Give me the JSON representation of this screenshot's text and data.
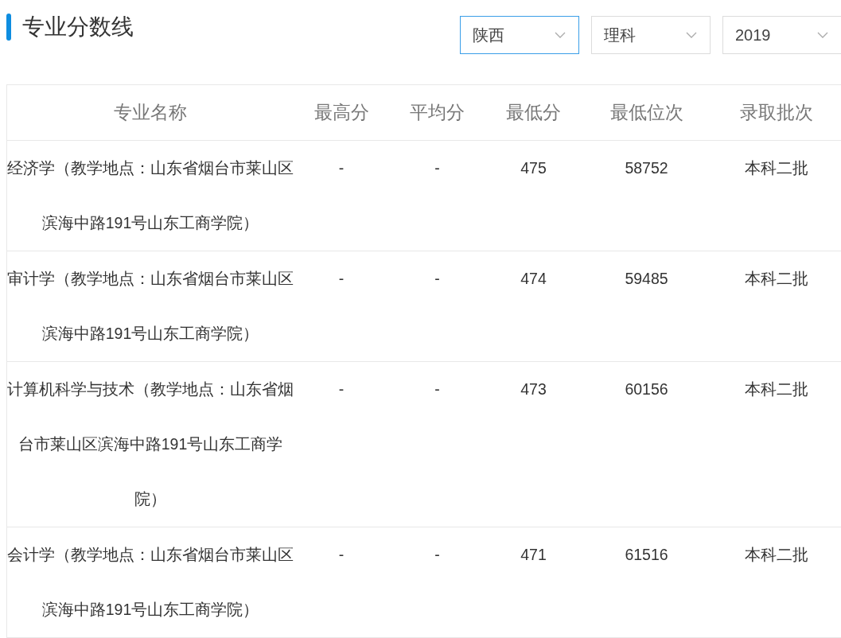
{
  "title": "专业分数线",
  "filters": [
    {
      "value": "陕西",
      "focused": true
    },
    {
      "value": "理科",
      "focused": false
    },
    {
      "value": "2019",
      "focused": false
    }
  ],
  "table": {
    "columns": [
      "专业名称",
      "最高分",
      "平均分",
      "最低分",
      "最低位次",
      "录取批次"
    ],
    "rows": [
      [
        "经济学（教学地点：山东省烟台市莱山区滨海中路191号山东工商学院）",
        "-",
        "-",
        "475",
        "58752",
        "本科二批"
      ],
      [
        "审计学（教学地点：山东省烟台市莱山区滨海中路191号山东工商学院）",
        "-",
        "-",
        "474",
        "59485",
        "本科二批"
      ],
      [
        "计算机科学与技术（教学地点：山东省烟台市莱山区滨海中路191号山东工商学院）",
        "-",
        "-",
        "473",
        "60156",
        "本科二批"
      ],
      [
        "会计学（教学地点：山东省烟台市莱山区滨海中路191号山东工商学院）",
        "-",
        "-",
        "471",
        "61516",
        "本科二批"
      ]
    ]
  }
}
